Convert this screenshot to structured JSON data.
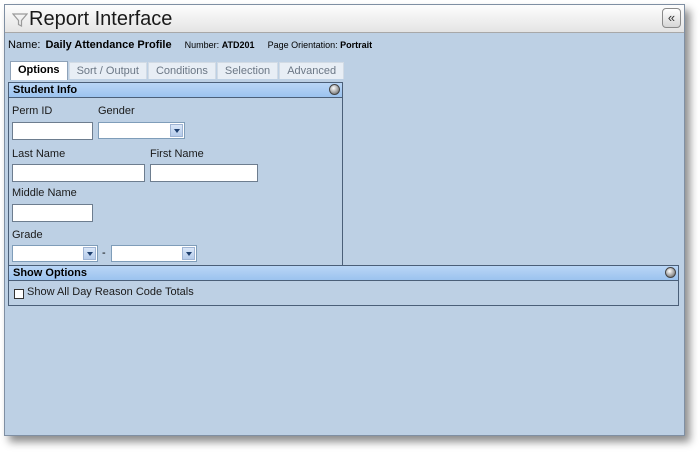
{
  "window": {
    "title": "Report Interface",
    "collapse_label": "«"
  },
  "report": {
    "name_label": "Name:",
    "name": "Daily Attendance Profile",
    "number_label": "Number:",
    "number": "ATD201",
    "orientation_label": "Page Orientation:",
    "orientation": "Portrait"
  },
  "tabs": [
    {
      "label": "Options",
      "active": true
    },
    {
      "label": "Sort / Output",
      "active": false
    },
    {
      "label": "Conditions",
      "active": false
    },
    {
      "label": "Selection",
      "active": false
    },
    {
      "label": "Advanced",
      "active": false
    }
  ],
  "student_info": {
    "header": "Student Info",
    "perm_id": {
      "label": "Perm ID",
      "value": ""
    },
    "gender": {
      "label": "Gender",
      "value": ""
    },
    "last_name": {
      "label": "Last Name",
      "value": ""
    },
    "first_name": {
      "label": "First Name",
      "value": ""
    },
    "middle_name": {
      "label": "Middle Name",
      "value": ""
    },
    "grade": {
      "label": "Grade",
      "from": "",
      "to": "",
      "separator": "-"
    }
  },
  "show_options": {
    "header": "Show Options",
    "show_all_day_reason": {
      "label": "Show All Day Reason Code Totals",
      "checked": false
    }
  },
  "icons": {
    "title": "funnel-icon",
    "panel_toggle": "collapse-circle-icon"
  }
}
